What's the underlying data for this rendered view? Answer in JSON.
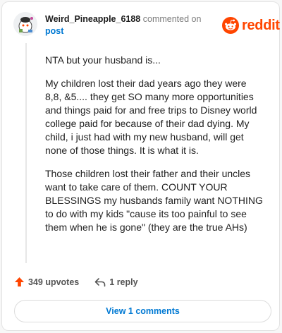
{
  "comment": {
    "username": "Weird_Pineapple_6188",
    "action_text": "commented on",
    "target_text": "post",
    "paragraphs": [
      "NTA but your husband is...",
      "My children lost their dad years ago they were 8,8, &5.... they get SO many more opportunities and things paid for and free trips to Disney world college paid for because of their dad dying. My child, i just had with my new husband, will get none of those things. It is what it is.",
      "Those children lost their father and their uncles want to take care of them. COUNT YOUR BLESSINGS my husbands family want NOTHING to do with my kids \"cause its too painful to see them when he is gone\" (they are the true AHs)"
    ],
    "upvotes_label": "349 upvotes",
    "reply_label": "1 reply",
    "view_comments_label": "View 1 comments"
  },
  "brand": {
    "logo_text": "reddit",
    "accent_color": "#ff4500",
    "link_color": "#0079d3"
  },
  "icons": {
    "avatar": "snoo-avatar",
    "logo": "reddit-logo-icon",
    "upvote": "upvote-arrow-icon",
    "reply": "reply-arrow-icon"
  }
}
